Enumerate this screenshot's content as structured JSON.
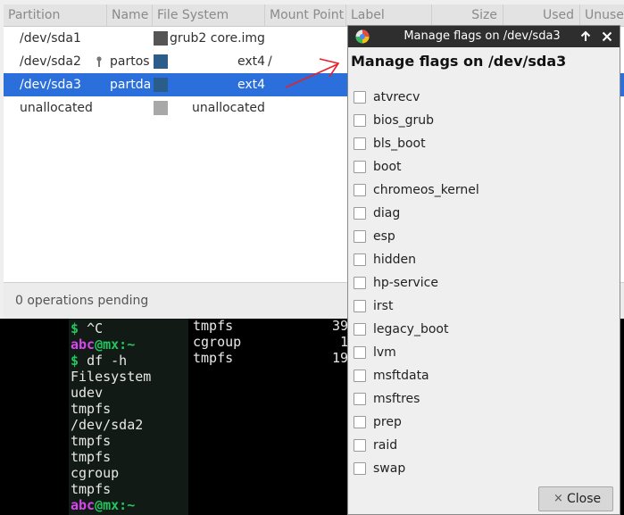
{
  "table": {
    "columns": [
      "Partition",
      "Name",
      "File System",
      "Mount Point",
      "Label",
      "Size",
      "Used",
      "Unused"
    ],
    "rows": [
      {
        "partition": "/dev/sda1",
        "name": "",
        "filesystem": "grub2 core.img",
        "mount": "",
        "color": "#555555"
      },
      {
        "partition": "/dev/sda2",
        "name": "partos",
        "filesystem": "ext4",
        "mount": "/",
        "color": "#2b5d8a"
      },
      {
        "partition": "/dev/sda3",
        "name": "partda",
        "filesystem": "ext4",
        "mount": "",
        "color": "#2b5d8a"
      },
      {
        "partition": "unallocated",
        "name": "",
        "filesystem": "unallocated",
        "mount": "",
        "color": "#a8a8a8"
      }
    ]
  },
  "status": {
    "operations": "0 operations pending"
  },
  "terminal": {
    "lines": [
      [
        {
          "c": "green",
          "t": "$ "
        },
        {
          "c": "white",
          "t": "^C"
        }
      ],
      [
        {
          "c": "pink",
          "t": "abc"
        },
        {
          "c": "green",
          "t": "@mx:~"
        }
      ],
      [
        {
          "c": "green",
          "t": "$ "
        },
        {
          "c": "white",
          "t": "df -h"
        }
      ],
      [
        {
          "c": "white",
          "t": "Filesystem"
        }
      ],
      [
        {
          "c": "white",
          "t": "udev"
        }
      ],
      [
        {
          "c": "white",
          "t": "tmpfs"
        }
      ],
      [
        {
          "c": "white",
          "t": "/dev/sda2"
        }
      ],
      [
        {
          "c": "white",
          "t": "tmpfs"
        }
      ],
      [
        {
          "c": "white",
          "t": "tmpfs"
        }
      ],
      [
        {
          "c": "white",
          "t": "cgroup"
        }
      ],
      [
        {
          "c": "white",
          "t": "tmpfs"
        }
      ],
      [
        {
          "c": "pink",
          "t": "abc"
        },
        {
          "c": "green",
          "t": "@mx:~"
        }
      ]
    ],
    "right_lines": [
      {
        "name": "tmpfs",
        "value": "39"
      },
      {
        "name": "cgroup",
        "value": "1"
      },
      {
        "name": "tmpfs",
        "value": "19"
      }
    ]
  },
  "dialog": {
    "title": "Manage flags on /dev/sda3",
    "heading": "Manage flags on /dev/sda3",
    "flags": [
      {
        "label": "atvrecv",
        "checked": false
      },
      {
        "label": "bios_grub",
        "checked": false
      },
      {
        "label": "bls_boot",
        "checked": false
      },
      {
        "label": "boot",
        "checked": false
      },
      {
        "label": "chromeos_kernel",
        "checked": false
      },
      {
        "label": "diag",
        "checked": false
      },
      {
        "label": "esp",
        "checked": false
      },
      {
        "label": "hidden",
        "checked": false
      },
      {
        "label": "hp-service",
        "checked": false
      },
      {
        "label": "irst",
        "checked": false
      },
      {
        "label": "legacy_boot",
        "checked": false
      },
      {
        "label": "lvm",
        "checked": false
      },
      {
        "label": "msftdata",
        "checked": false
      },
      {
        "label": "msftres",
        "checked": false
      },
      {
        "label": "prep",
        "checked": false
      },
      {
        "label": "raid",
        "checked": false
      },
      {
        "label": "swap",
        "checked": false
      }
    ],
    "close_label": "Close",
    "close_icon": "×"
  },
  "annotation_color": "#e8202a",
  "selection_color": "#2a6fdb"
}
